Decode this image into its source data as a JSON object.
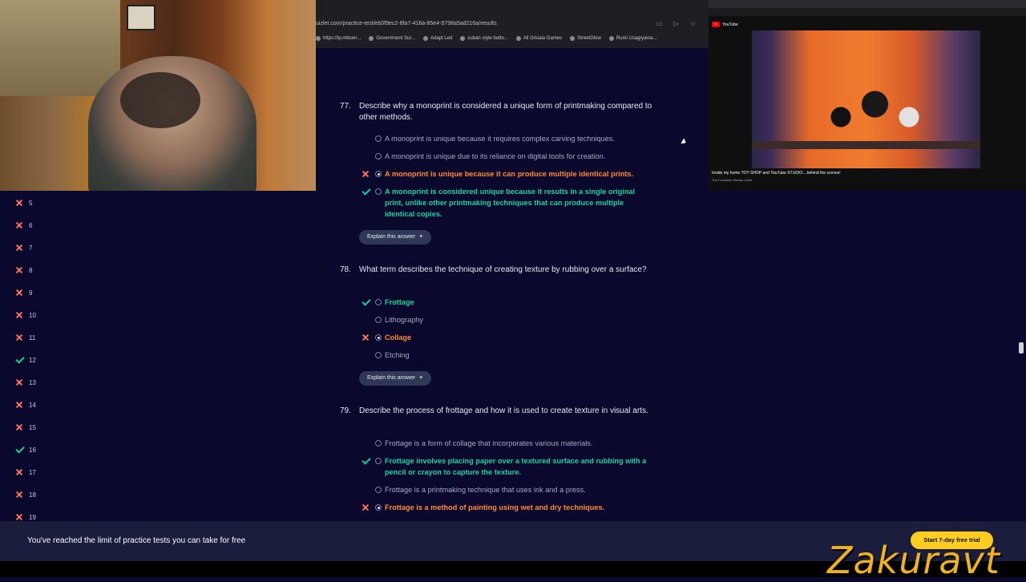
{
  "browser": {
    "url": "uizlet.com/practice-test/eb0f9ec2-8fa7-416a-85e4-9798a5ad216a/results",
    "bookmarks": [
      "https://lp.mbsen...",
      "Government Sur...",
      "Adapt Led",
      "cuban style butto...",
      "All Grisaia Games",
      "StreetGlow",
      "Rumi Usagiyama..."
    ]
  },
  "youtube": {
    "brand": "YouTube",
    "video_title": "Inside my home TOY SHOP and YouTube STUDIO... behind the scenes!",
    "channel": "The Container Steady Collor"
  },
  "sidebar": {
    "items": [
      {
        "num": "5",
        "status": "wrong"
      },
      {
        "num": "6",
        "status": "wrong"
      },
      {
        "num": "7",
        "status": "wrong"
      },
      {
        "num": "8",
        "status": "wrong"
      },
      {
        "num": "9",
        "status": "wrong"
      },
      {
        "num": "10",
        "status": "wrong"
      },
      {
        "num": "11",
        "status": "wrong"
      },
      {
        "num": "12",
        "status": "correct"
      },
      {
        "num": "13",
        "status": "wrong"
      },
      {
        "num": "14",
        "status": "wrong"
      },
      {
        "num": "15",
        "status": "wrong"
      },
      {
        "num": "16",
        "status": "correct"
      },
      {
        "num": "17",
        "status": "wrong"
      },
      {
        "num": "18",
        "status": "wrong"
      },
      {
        "num": "19",
        "status": "wrong"
      }
    ]
  },
  "questions": [
    {
      "number": "77.",
      "text": "Describe why a monoprint is considered a unique form of printmaking compared to other methods.",
      "options": [
        {
          "text": "A monoprint is unique because it requires complex carving techniques.",
          "state": "neutral"
        },
        {
          "text": "A monoprint is unique due to its reliance on digital tools for creation.",
          "state": "neutral"
        },
        {
          "text": "A monoprint is unique because it can produce multiple identical prints.",
          "state": "wrong"
        },
        {
          "text": "A monoprint is considered unique because it results in a single original print, unlike other printmaking techniques that can produce multiple identical copies.",
          "state": "right"
        }
      ],
      "explain_label": "Explain this answer"
    },
    {
      "number": "78.",
      "text": "What term describes the technique of creating texture by rubbing over a surface?",
      "options": [
        {
          "text": "Frottage",
          "state": "right"
        },
        {
          "text": "Lithography",
          "state": "neutral"
        },
        {
          "text": "Collage",
          "state": "wrong"
        },
        {
          "text": "Etching",
          "state": "neutral"
        }
      ],
      "explain_label": "Explain this answer"
    },
    {
      "number": "79.",
      "text": "Describe the process of frottage and how it is used to create texture in visual arts.",
      "options": [
        {
          "text": "Frottage is a form of collage that incorporates various materials.",
          "state": "neutral"
        },
        {
          "text": "Frottage involves placing paper over a textured surface and rubbing with a pencil or crayon to capture the texture.",
          "state": "right"
        },
        {
          "text": "Frottage is a printmaking technique that uses ink and a press.",
          "state": "neutral"
        },
        {
          "text": "Frottage is a method of painting using wet and dry techniques.",
          "state": "wrong"
        }
      ]
    }
  ],
  "banner": {
    "text": "You've reached the limit of practice tests you can take for free",
    "cta": "Start 7-day free trial"
  },
  "watermark": "Zakuravt",
  "colors": {
    "background": "#0a092d",
    "wrong": "#ff8a34",
    "right": "#18d4a0",
    "cta": "#ffcd1f"
  }
}
